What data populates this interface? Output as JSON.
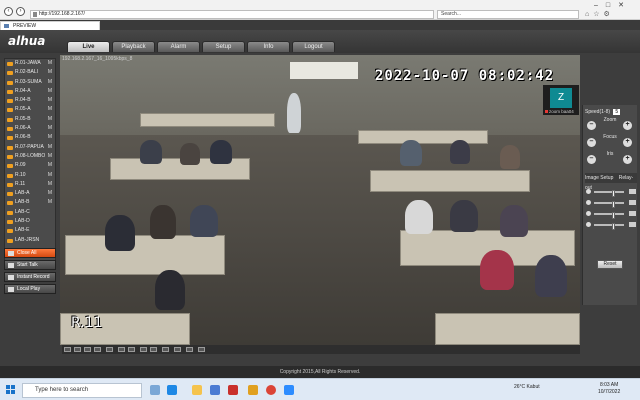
{
  "browser": {
    "url": "http://192.168.2.167/",
    "search_placeholder": "Search...",
    "tab_title": "PREVIEW"
  },
  "app": {
    "logo": "alhua",
    "nav": [
      "Live",
      "Playback",
      "Alarm",
      "Setup",
      "Info",
      "Logout"
    ],
    "active_nav": "Live"
  },
  "channels": [
    {
      "name": "R.01-JAWA",
      "flag": "M"
    },
    {
      "name": "R.02-BALI",
      "flag": "M"
    },
    {
      "name": "R.03-SUMA",
      "flag": "M"
    },
    {
      "name": "R.04-A",
      "flag": "M"
    },
    {
      "name": "R.04-B",
      "flag": "M"
    },
    {
      "name": "R.05-A",
      "flag": "M"
    },
    {
      "name": "R.05-B",
      "flag": "M"
    },
    {
      "name": "R.06-A",
      "flag": "M"
    },
    {
      "name": "R.06-B",
      "flag": "M"
    },
    {
      "name": "R.07-PAPUA",
      "flag": "M"
    },
    {
      "name": "R.08-LOMBO",
      "flag": "M"
    },
    {
      "name": "R.09",
      "flag": "M"
    },
    {
      "name": "R.10",
      "flag": "M"
    },
    {
      "name": "R.11",
      "flag": "M"
    },
    {
      "name": "LAB-A",
      "flag": "M"
    },
    {
      "name": "LAB-B",
      "flag": "M"
    },
    {
      "name": "LAB-C",
      "flag": ""
    },
    {
      "name": "LAB-D",
      "flag": ""
    },
    {
      "name": "LAB-E",
      "flag": ""
    },
    {
      "name": "LAB-JRSN",
      "flag": ""
    }
  ],
  "side_buttons": {
    "close_all": "Close All",
    "start_talk": "Start Talk",
    "instant_record": "Instant Record",
    "local_play": "Local Play"
  },
  "video": {
    "title": "192.168.2.167_16_1095kbps_8",
    "timestamp": "2022-10-07 08:02:42",
    "label": "R.11"
  },
  "zoom_popup": {
    "avatar_letter": "Z",
    "label": "zoom baa04"
  },
  "ptz": {
    "speed_label": "Speed(1-8)",
    "speed_value": "5",
    "zoom": "Zoom",
    "focus": "Focus",
    "iris": "Iris",
    "image_setup": "Image Setup",
    "relay_out": "Relay-out",
    "reset": "Reset"
  },
  "footer": "Copyright 2015,All Rights Reserved.",
  "taskbar": {
    "search_placeholder": "Type here to search",
    "weather": "26°C Kabut",
    "time": "8:03 AM",
    "date": "10/7/2022"
  }
}
